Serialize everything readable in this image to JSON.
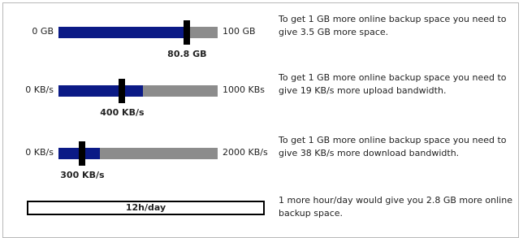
{
  "storage": {
    "min": "0 GB",
    "max": "100 GB",
    "value": "80.8 GB",
    "fraction": 0.808,
    "description": "To get 1 GB more online backup space you need to give 3.5 GB more space."
  },
  "upload": {
    "min": "0 KB/s",
    "max": "1000 KBs",
    "value": "400 KB/s",
    "fraction": 0.4,
    "fill_fraction": 0.53,
    "description": "To get 1 GB more online backup space you need to give 19 KB/s more upload bandwidth."
  },
  "download": {
    "min": "0 KB/s",
    "max": "2000 KB/s",
    "value": "300 KB/s",
    "fraction": 0.15,
    "fill_fraction": 0.26,
    "description": "To get 1 GB more online backup space you need to give 38 KB/s more download bandwidth."
  },
  "hours": {
    "value": "12h/day",
    "description": "1 more hour/day would give you 2.8 GB more online backup space."
  },
  "colors": {
    "fill": "#0b1a86",
    "track": "#8c8c8c",
    "thumb": "#000000"
  }
}
